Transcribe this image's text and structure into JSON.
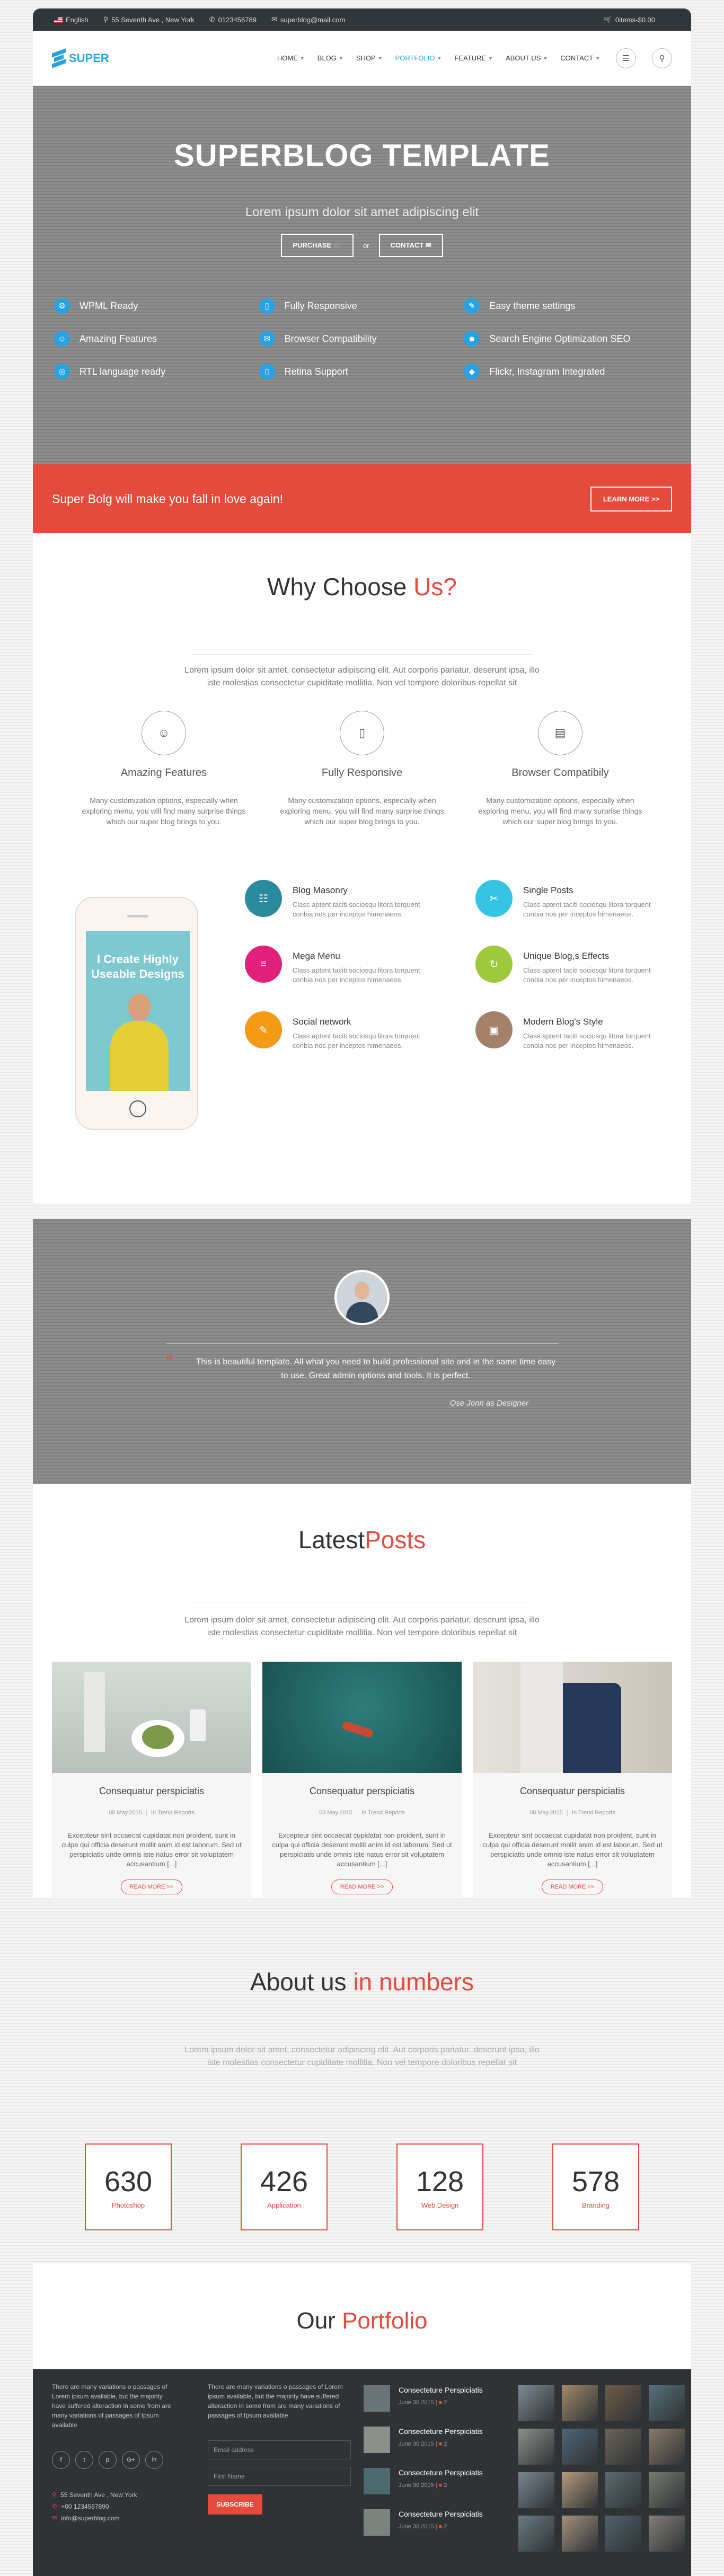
{
  "topbar": {
    "language": "English",
    "address": "55 Seventh Ave , New York",
    "phone": "0123456789",
    "email": "superblog@mail.com",
    "cart": "0items-$0.00"
  },
  "header": {
    "logo_text": "SUPER",
    "nav": [
      "HOME",
      "BLOG",
      "SHOP",
      "PORTFOLIO",
      "FEATURE",
      "ABOUT US",
      "CONTACT"
    ],
    "nav_has_dropdown": [
      true,
      true,
      true,
      true,
      true,
      true,
      true
    ],
    "active_nav": "PORTFOLIO"
  },
  "hero": {
    "title": "SUPERBLOG TEMPLATE",
    "tagline": "Lorem ipsum dolor sit amet adipiscing elit",
    "purchase_label": "PURCHASE",
    "or_label": "or",
    "contact_label": "CONTACT",
    "features": [
      {
        "icon": "wpml-icon",
        "label": "WPML Ready"
      },
      {
        "icon": "mobile-icon",
        "label": "Fully Responsive"
      },
      {
        "icon": "pencil-icon",
        "label": "Easy theme settings"
      },
      {
        "icon": "users-icon",
        "label": "Amazing Features"
      },
      {
        "icon": "chat-icon",
        "label": "Browser Compatibility"
      },
      {
        "icon": "person-icon",
        "label": "Search Engine Optimization SEO"
      },
      {
        "icon": "globe-icon",
        "label": "RTL language ready"
      },
      {
        "icon": "mobile-icon",
        "label": "Retina Support"
      },
      {
        "icon": "diamond-icon",
        "label": "Flickr, Instagram Integrated"
      }
    ]
  },
  "banner": {
    "text": "Super Bolg will make you fall in love again!",
    "button": "LEARN MORE >>"
  },
  "why": {
    "title_plain": "Why Choose",
    "title_highlight": "Us?",
    "lead": "Lorem ipsum dolor sit amet, consectetur adipiscing elit. Aut corporis pariatur, deserunt ipsa, illo iste molestias consectetur cupiditate mollitia. Non vel tempore doloribus repellat sit",
    "items": [
      {
        "icon": "users-icon",
        "title": "Amazing Features",
        "text": "Many customization options, especially when exploring menu, you will find many surprise things which our super blog brings to you."
      },
      {
        "icon": "mobile-icon",
        "title": "Fully Responsive",
        "text": "Many customization options, especially when exploring menu, you will find many surprise things which our super blog brings to you."
      },
      {
        "icon": "browser-icon",
        "title": "Browser Compatibily",
        "text": "Many customization options, especially when exploring menu, you will find many surprise things which our super blog brings to you."
      }
    ]
  },
  "showcase": {
    "phone_text": "I Create Highly Useable Designs",
    "services": [
      {
        "icon": "masonry-icon",
        "color": "#2b8b9e",
        "title": "Blog Masonry",
        "text": "Class aptent taciti sociosqu litora torquent conbia nos per inceptos himenaeos."
      },
      {
        "icon": "scissors-icon",
        "color": "#35c4e4",
        "title": "Single Posts",
        "text": "Class aptent taciti sociosqu litora torquent conbia nos per inceptos himenaeos."
      },
      {
        "icon": "menu-icon",
        "color": "#e0207a",
        "title": "Mega Menu",
        "text": "Class aptent taciti sociosqu litora torquent conbia nos per inceptos himenaeos."
      },
      {
        "icon": "refresh-icon",
        "color": "#9fc83c",
        "title": "Unique Blog,s Effects",
        "text": "Class aptent taciti sociosqu litora torquent conbia nos per inceptos himenaeos."
      },
      {
        "icon": "pencil-icon",
        "color": "#f39a16",
        "title": "Social network",
        "text": "Class aptent taciti sociosqu litora torquent conbia nos per inceptos himenaeos."
      },
      {
        "icon": "bag-icon",
        "color": "#a4826a",
        "title": "Modern Blog's Style",
        "text": "Class aptent taciti sociosqu litora torquent conbia nos per inceptos himenaeos."
      }
    ]
  },
  "testimonial": {
    "quote": "This is beautiful template. All what you need to build professional site and in the same time easy to use. Great admin options and tools. It is perfect.",
    "author": "Ose Jonn as Designer"
  },
  "posts": {
    "title_plain": "Latest",
    "title_highlight": "Posts",
    "lead": "Lorem ipsum dolor sit amet, consectetur adipiscing elit. Aut corporis pariatur, deserunt ipsa, illo iste molestias consectetur cupiditate mollitia. Non vel tempore doloribus repellat sit",
    "items": [
      {
        "title": "Consequatur perspiciatis",
        "date": "08.May.2015",
        "category": "In Trend Reports",
        "text": "Excepteur sint occaecat cupidatat non proident, sunt in culpa qui officia deserunt mollit anim id est laborum. Sed ut perspiciatis unde omnis iste natus error sit voluptatem accusantium [...]",
        "button": "READ MORE >>"
      },
      {
        "title": "Consequatur perspiciatis",
        "date": "08.May.2015",
        "category": "In Trend Reports",
        "text": "Excepteur sint occaecat cupidatat non proident, sunt in culpa qui officia deserunt mollit anim id est laborum. Sed ut perspiciatis unde omnis iste natus error sit voluptatem accusantium [...]",
        "button": "READ MORE >>"
      },
      {
        "title": "Consequatur perspiciatis",
        "date": "08.May.2015",
        "category": "In Trend Reports",
        "text": "Excepteur sint occaecat cupidatat non proident, sunt in culpa qui officia deserunt mollit anim id est laborum. Sed ut perspiciatis unde omnis iste natus error sit voluptatem accusantium [...]",
        "button": "READ MORE >>"
      }
    ]
  },
  "numbers": {
    "title_plain": "About us",
    "title_highlight": "in numbers",
    "lead": "Lorem ipsum dolor sit amet, consectetur adipiscing elit. Aut corporis pariatur, deserunt ipsa, illo iste molestias consectetur cupiditate mollitia. Non vel tempore doloribus repellat sit",
    "items": [
      {
        "value": "630",
        "label": "Photoshop"
      },
      {
        "value": "426",
        "label": "Application"
      },
      {
        "value": "128",
        "label": "Web Design"
      },
      {
        "value": "578",
        "label": "Branding"
      }
    ]
  },
  "portfolio": {
    "title_plain": "Our",
    "title_highlight": "Portfolio"
  },
  "footer": {
    "about_text": "There are many variations o passages of Lorem ipsum available, but the majority have suffered alteraction in some from are many variations of passages of Ipsum available",
    "social": [
      "f",
      "t",
      "p",
      "G+",
      "in"
    ],
    "address": "55 Seventh Ave , New York",
    "phone": "+00 1234567890",
    "email": "info@superblog.com",
    "newsletter_text": "There are many variations o passages of Lorem ipsum available, but the majority have suffered alteraction in some from are many variations of passages of Ipsum available",
    "email_placeholder": "Email address",
    "name_placeholder": "First Name",
    "subscribe": "SUBSCRIBE",
    "recent_posts": [
      {
        "title": "Consecteture Perspiciatis",
        "date": "June 30 2015",
        "comments": "2"
      },
      {
        "title": "Consecteture Perspiciatis",
        "date": "June 30 2015",
        "comments": "2"
      },
      {
        "title": "Consecteture Perspiciatis",
        "date": "June 30 2015",
        "comments": "2"
      },
      {
        "title": "Consecteture Perspiciatis",
        "date": "June 30 2015",
        "comments": "2"
      }
    ]
  },
  "colors": {
    "accent": "#e54b3c",
    "brand_blue": "#2aa1e0",
    "dark": "#30363a"
  }
}
